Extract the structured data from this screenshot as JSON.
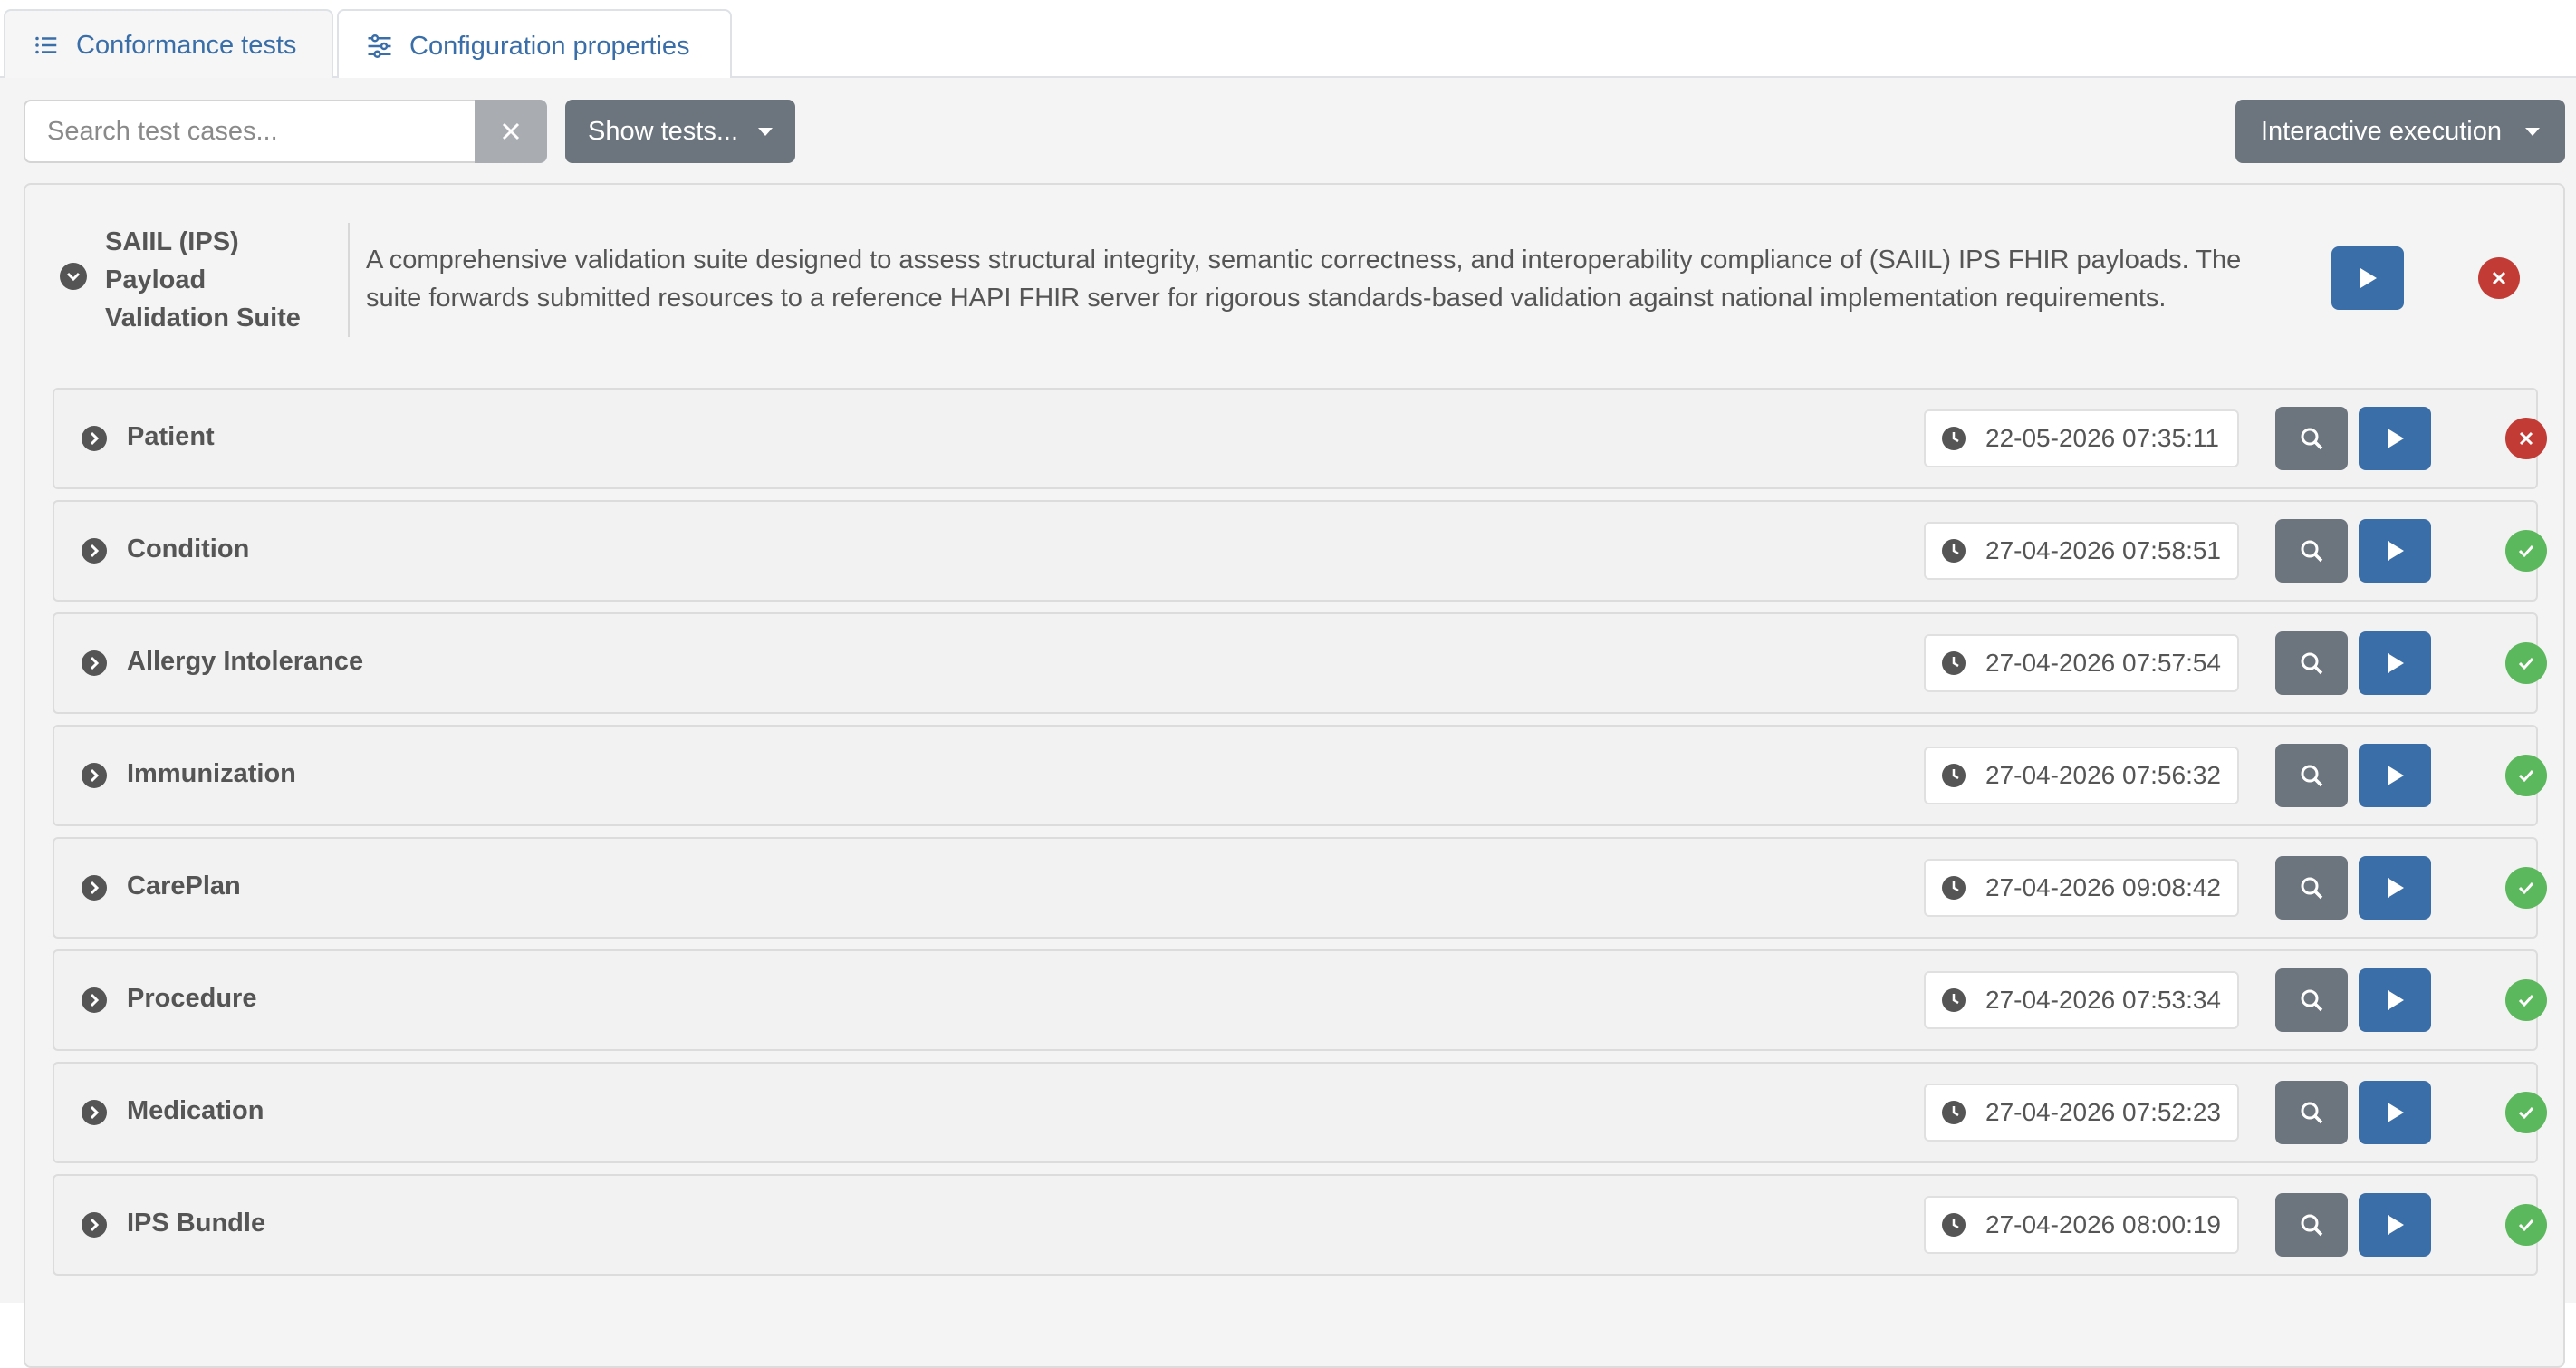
{
  "tabs": [
    {
      "label": "Conformance tests",
      "icon": "list-icon",
      "active": false
    },
    {
      "label": "Configuration properties",
      "icon": "sliders-icon",
      "active": true
    }
  ],
  "toolbar": {
    "search_placeholder": "Search test cases...",
    "clear_icon": "close-icon",
    "show_tests_label": "Show tests...",
    "execution_label": "Interactive execution"
  },
  "suite": {
    "name": "SAIIL (IPS) Payload Validation Suite",
    "description": "A comprehensive validation suite designed to assess structural integrity, semantic correctness, and interoperability compliance of (SAIIL) IPS FHIR payloads. The suite forwards submitted resources to a reference HAPI FHIR server for rigorous standards-based validation against national implementation requirements.",
    "status": "fail"
  },
  "test_cases": [
    {
      "name": "Patient",
      "timestamp": "22-05-2026 07:35:11",
      "status": "fail"
    },
    {
      "name": "Condition",
      "timestamp": "27-04-2026 07:58:51",
      "status": "pass"
    },
    {
      "name": "Allergy Intolerance",
      "timestamp": "27-04-2026 07:57:54",
      "status": "pass"
    },
    {
      "name": "Immunization",
      "timestamp": "27-04-2026 07:56:32",
      "status": "pass"
    },
    {
      "name": "CarePlan",
      "timestamp": "27-04-2026 09:08:42",
      "status": "pass"
    },
    {
      "name": "Procedure",
      "timestamp": "27-04-2026 07:53:34",
      "status": "pass"
    },
    {
      "name": "Medication",
      "timestamp": "27-04-2026 07:52:23",
      "status": "pass"
    },
    {
      "name": "IPS Bundle",
      "timestamp": "27-04-2026 08:00:19",
      "status": "pass"
    }
  ],
  "colors": {
    "primary": "#3a6ea8",
    "secondary": "#6c757d",
    "success": "#5cb85c",
    "danger": "#c33b35"
  }
}
